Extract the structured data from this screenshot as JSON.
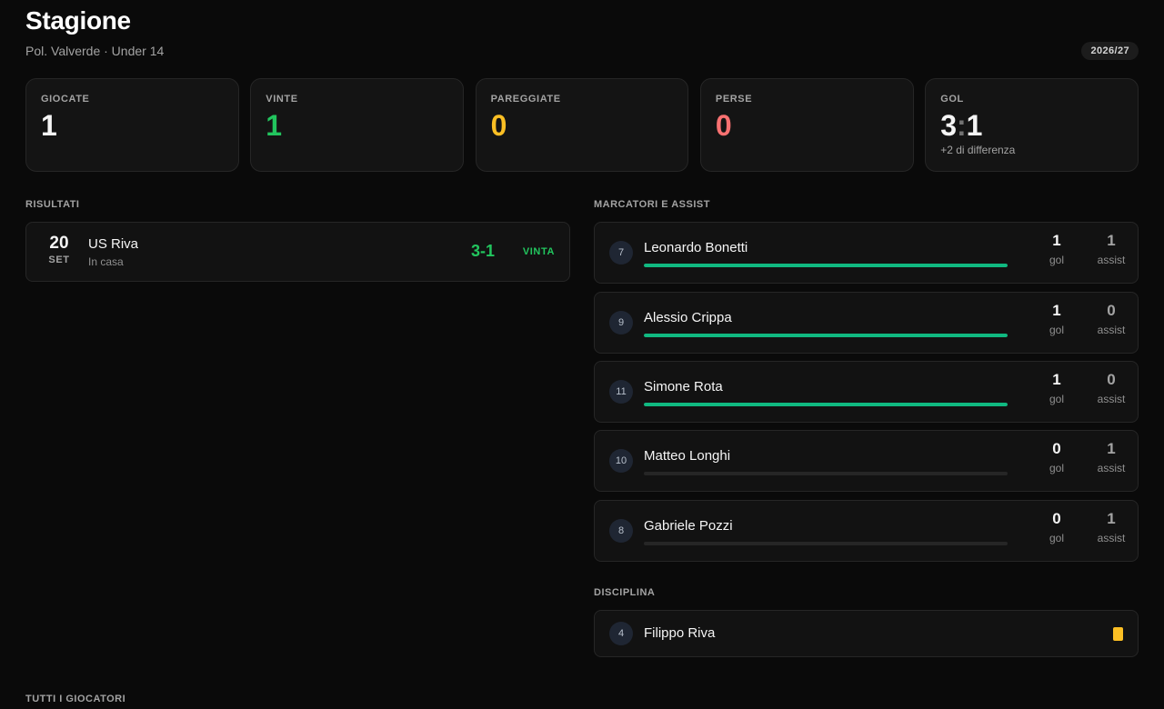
{
  "header": {
    "title": "Stagione",
    "subtitle": "Pol. Valverde · Under 14",
    "season": "2026/27"
  },
  "stats": {
    "played": {
      "label": "GIOCATE",
      "value": "1"
    },
    "won": {
      "label": "VINTE",
      "value": "1"
    },
    "drawn": {
      "label": "PAREGGIATE",
      "value": "0"
    },
    "lost": {
      "label": "PERSE",
      "value": "0"
    },
    "goals": {
      "label": "GOL",
      "for": "3",
      "sep": ":",
      "against": "1",
      "diff": "+2 di differenza"
    }
  },
  "results": {
    "label": "RISULTATI",
    "matches": [
      {
        "day": "20",
        "month": "SET",
        "opponent": "US Riva",
        "venue": "In casa",
        "score": "3-1",
        "outcome": "VINTA"
      }
    ]
  },
  "scorers": {
    "label": "MARCATORI E ASSIST",
    "goal_unit": "gol",
    "assist_unit": "assist",
    "players": [
      {
        "number": "7",
        "name": "Leonardo Bonetti",
        "goals": "1",
        "assists": "1",
        "bar_fraction": 1.0
      },
      {
        "number": "9",
        "name": "Alessio Crippa",
        "goals": "1",
        "assists": "0",
        "bar_fraction": 1.0
      },
      {
        "number": "11",
        "name": "Simone Rota",
        "goals": "1",
        "assists": "0",
        "bar_fraction": 1.0
      },
      {
        "number": "10",
        "name": "Matteo Longhi",
        "goals": "0",
        "assists": "1",
        "bar_fraction": 0.0
      },
      {
        "number": "8",
        "name": "Gabriele Pozzi",
        "goals": "0",
        "assists": "1",
        "bar_fraction": 0.0
      }
    ]
  },
  "discipline": {
    "label": "DISCIPLINA",
    "players": [
      {
        "number": "4",
        "name": "Filippo Riva",
        "card": "yellow-card-icon"
      }
    ]
  },
  "all_players": {
    "label": "TUTTI I GIOCATORI"
  },
  "colors": {
    "background": "#0a0a0a",
    "win": "#22c55e",
    "draw": "#fbbf24",
    "loss": "#f87171",
    "bar": "#10b981"
  }
}
